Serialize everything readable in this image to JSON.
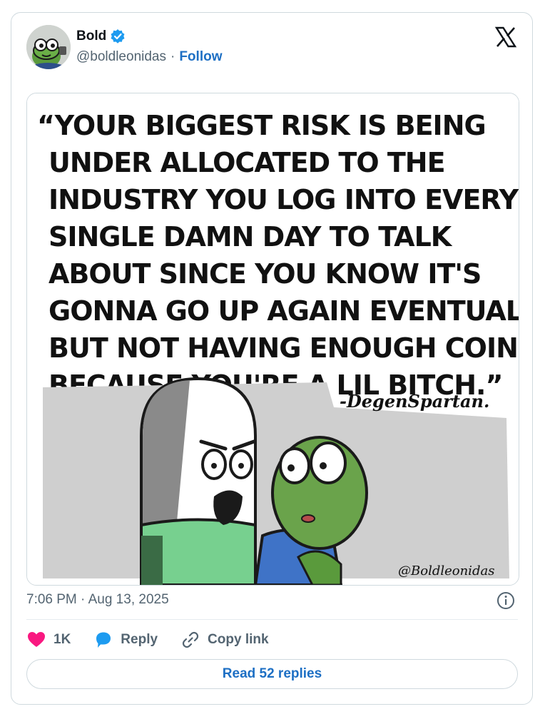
{
  "author": {
    "name": "Bold",
    "handle": "@boldleonidas",
    "separator": "·",
    "follow_label": "Follow"
  },
  "media": {
    "quote_lines": [
      "“YOUR BIGGEST RISK IS BEING",
      "UNDER ALLOCATED TO THE",
      "INDUSTRY YOU LOG INTO EVERY",
      "SINGLE DAMN DAY TO TALK",
      "ABOUT SINCE YOU KNOW IT'S",
      "GONNA GO UP AGAIN EVENTUALLY",
      "BUT NOT HAVING ENOUGH COINS",
      "BECAUSE YOU'RE A LIL BITCH.”"
    ],
    "attribution": "-DegenSpartan.",
    "signature": "@Boldleonidas"
  },
  "timestamp": "7:06 PM · Aug 13, 2025",
  "actions": {
    "likes": "1K",
    "reply_label": "Reply",
    "copy_link_label": "Copy link"
  },
  "read_replies_label": "Read 52 replies",
  "icons": {
    "verified": "verified-badge-icon",
    "x": "x-logo-icon",
    "info": "info-icon",
    "heart": "heart-icon",
    "reply": "reply-bubble-icon",
    "link": "link-icon"
  },
  "colors": {
    "accent": "#1d6fc4",
    "heart": "#f91880",
    "muted": "#536471",
    "border": "#cfd9de"
  }
}
